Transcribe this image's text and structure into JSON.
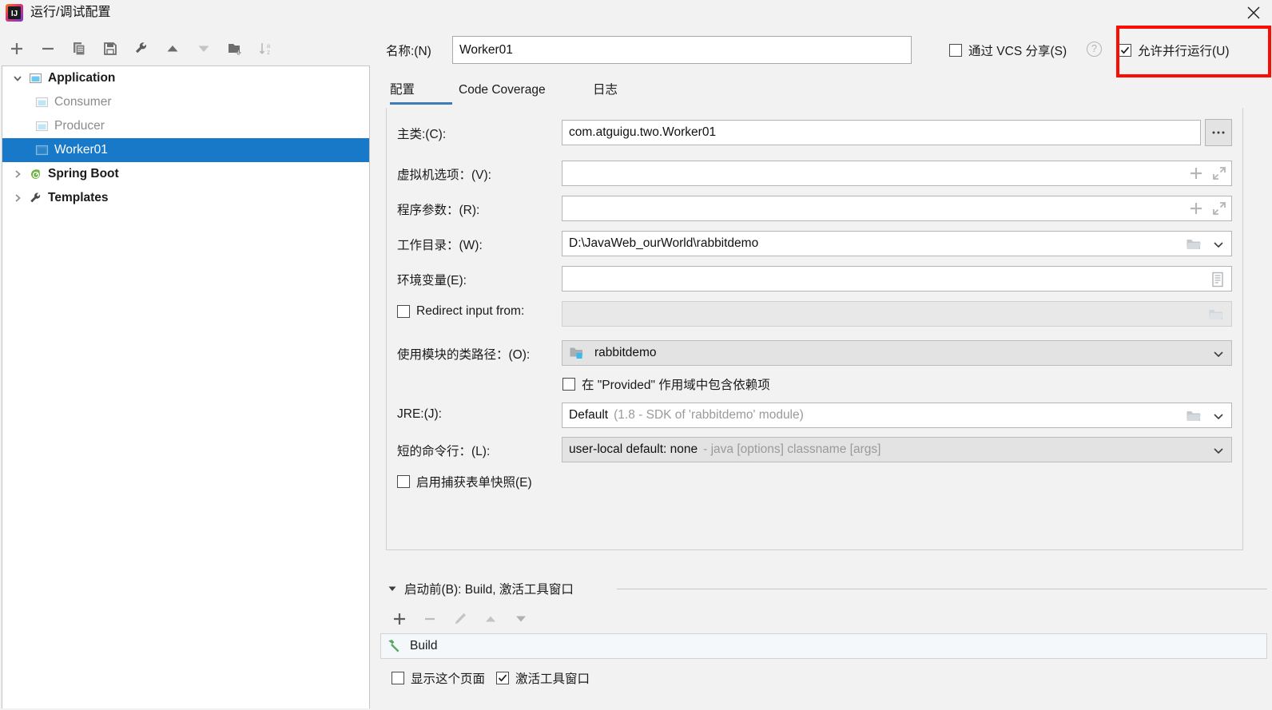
{
  "window": {
    "title": "运行/调试配置",
    "app_icon": "intellij-idea-icon",
    "close_label": "✕"
  },
  "toolbar": {
    "items": [
      {
        "name": "add-configuration-button",
        "icon": "plus-icon",
        "label": "+"
      },
      {
        "name": "remove-configuration-button",
        "icon": "minus-icon",
        "label": "−"
      },
      {
        "name": "copy-configuration-button",
        "icon": "copy-icon",
        "label": "copy"
      },
      {
        "name": "save-configuration-button",
        "icon": "save-icon",
        "label": "save"
      },
      {
        "name": "edit-templates-button",
        "icon": "wrench-icon",
        "label": "wrench"
      },
      {
        "name": "move-up-button",
        "icon": "arrow-up-icon",
        "label": "up"
      },
      {
        "name": "move-down-button",
        "icon": "arrow-down-icon",
        "label": "down"
      },
      {
        "name": "create-folder-button",
        "icon": "new-folder-icon",
        "label": "folder"
      },
      {
        "name": "sort-configurations-button",
        "icon": "sort-az-icon",
        "label": "sort"
      }
    ]
  },
  "tree": {
    "nodes": [
      {
        "label": "Application",
        "level": 0,
        "expanded": true,
        "bold": true,
        "dim": false,
        "selected": false,
        "icon": "application-icon"
      },
      {
        "label": "Consumer",
        "level": 1,
        "expanded": null,
        "bold": false,
        "dim": true,
        "selected": false,
        "icon": "application-icon"
      },
      {
        "label": "Producer",
        "level": 1,
        "expanded": null,
        "bold": false,
        "dim": true,
        "selected": false,
        "icon": "application-icon"
      },
      {
        "label": "Worker01",
        "level": 1,
        "expanded": null,
        "bold": false,
        "dim": false,
        "selected": true,
        "icon": "application-icon"
      },
      {
        "label": "Spring Boot",
        "level": 0,
        "expanded": false,
        "bold": true,
        "dim": false,
        "selected": false,
        "icon": "spring-boot-icon"
      },
      {
        "label": "Templates",
        "level": 0,
        "expanded": false,
        "bold": true,
        "dim": false,
        "selected": false,
        "icon": "wrench-icon"
      }
    ]
  },
  "header": {
    "name_label": "名称:(N)",
    "name_value": "Worker01",
    "share_vcs_label": "通过 VCS 分享(S)",
    "share_vcs_checked": false,
    "help_label": "?",
    "allow_parallel_label": "允许并行运行(U)",
    "allow_parallel_checked": true,
    "highlight_color": "#fb0d04"
  },
  "tabs": {
    "items": [
      {
        "label": "配置",
        "selected": true
      },
      {
        "label": "Code Coverage",
        "selected": false
      },
      {
        "label": "日志",
        "selected": false
      }
    ],
    "accent_color": "#3f7cb5"
  },
  "form": {
    "main_class": {
      "label": "主类:(C):",
      "value": "com.atguigu.two.Worker01",
      "browse_label": "..."
    },
    "vm_options": {
      "label": "虚拟机选项：(V):",
      "value": "",
      "expand_icon": "expand-icon",
      "add_icon": "plus-icon"
    },
    "program_arguments": {
      "label": "程序参数：(R):",
      "value": "",
      "expand_icon": "expand-icon",
      "add_icon": "plus-icon"
    },
    "working_directory": {
      "label": "工作目录：(W):",
      "value": "D:\\JavaWeb_ourWorld\\rabbitdemo",
      "folder_icon": "folder-icon",
      "dropdown_icon": "chevron-down-icon"
    },
    "environment_variables": {
      "label": "环境变量(E):",
      "value": "",
      "list_icon": "document-list-icon"
    },
    "redirect_input": {
      "label": "Redirect input from:",
      "checked": false,
      "value": "",
      "folder_icon": "folder-icon"
    },
    "module_classpath": {
      "label": "使用模块的类路径：(O):",
      "value": "rabbitdemo",
      "module_icon": "module-folder-icon",
      "dropdown_icon": "chevron-down-icon"
    },
    "include_provided": {
      "label": "在 \"Provided\" 作用域中包含依赖项",
      "checked": false
    },
    "jre": {
      "label": "JRE:(J):",
      "value": "Default",
      "hint": "(1.8 - SDK of 'rabbitdemo' module)",
      "folder_icon": "folder-icon",
      "dropdown_icon": "chevron-down-icon"
    },
    "shorten_command_line": {
      "label": "短的命令行：(L):",
      "value": "user-local default: none",
      "hint": "- java [options] classname [args]",
      "dropdown_icon": "chevron-down-icon"
    },
    "capture_form_snapshots": {
      "label": "启用捕获表单快照(E)",
      "checked": false
    }
  },
  "before_launch": {
    "header": "启动前(B): Build, 激活工具窗口",
    "collapse_icon": "triangle-down-icon",
    "toolbar": [
      {
        "name": "add-task-button",
        "icon": "plus-icon",
        "label": "+",
        "enabled": true
      },
      {
        "name": "remove-task-button",
        "icon": "minus-icon",
        "label": "−",
        "enabled": false
      },
      {
        "name": "edit-task-button",
        "icon": "pencil-icon",
        "label": "edit",
        "enabled": false
      },
      {
        "name": "move-task-up-button",
        "icon": "arrow-up-icon",
        "label": "up",
        "enabled": false
      },
      {
        "name": "move-task-down-button",
        "icon": "arrow-down-icon",
        "label": "down",
        "enabled": false
      }
    ],
    "tasks": [
      {
        "label": "Build",
        "icon": "hammer-icon"
      }
    ],
    "show_this_page": {
      "label": "显示这个页面",
      "checked": false
    },
    "activate_tool_window": {
      "label": "激活工具窗口",
      "checked": true
    }
  }
}
